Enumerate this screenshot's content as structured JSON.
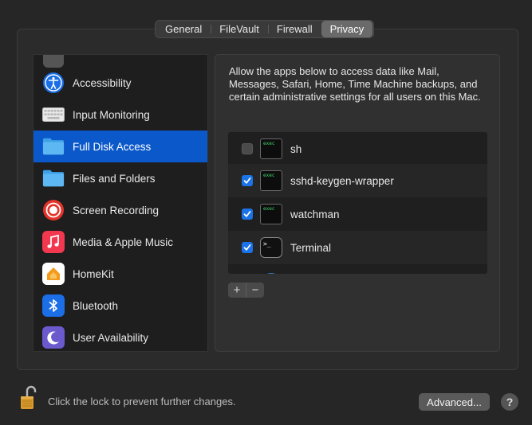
{
  "tabs": [
    {
      "label": "General"
    },
    {
      "label": "FileVault"
    },
    {
      "label": "Firewall"
    },
    {
      "label": "Privacy"
    }
  ],
  "sidebar": {
    "items": [
      {
        "label": "Accessibility",
        "icon": "accessibility-icon"
      },
      {
        "label": "Input Monitoring",
        "icon": "keyboard-icon"
      },
      {
        "label": "Full Disk Access",
        "icon": "folder-icon",
        "selected": true
      },
      {
        "label": "Files and Folders",
        "icon": "folder-icon"
      },
      {
        "label": "Screen Recording",
        "icon": "screen-recording-icon"
      },
      {
        "label": "Media & Apple Music",
        "icon": "music-icon"
      },
      {
        "label": "HomeKit",
        "icon": "home-icon"
      },
      {
        "label": "Bluetooth",
        "icon": "bluetooth-icon"
      },
      {
        "label": "User Availability",
        "icon": "moon-icon"
      }
    ]
  },
  "panel": {
    "description": "Allow the apps below to access data like Mail, Messages, Safari, Home, Time Machine backups, and certain administrative settings for all users on this Mac.",
    "apps": [
      {
        "name": "sh",
        "checked": false,
        "icon": "terminal-exec-icon"
      },
      {
        "name": "sshd-keygen-wrapper",
        "checked": true,
        "icon": "terminal-exec-icon"
      },
      {
        "name": "watchman",
        "checked": true,
        "icon": "terminal-exec-icon"
      },
      {
        "name": "Terminal",
        "checked": true,
        "icon": "terminal-app-icon"
      }
    ],
    "add_label": "+",
    "remove_label": "−"
  },
  "footer": {
    "lock_text": "Click the lock to prevent further changes.",
    "advanced_label": "Advanced...",
    "help_label": "?"
  },
  "colors": {
    "selection": "#0a58ca",
    "checkbox": "#1a73e8"
  }
}
